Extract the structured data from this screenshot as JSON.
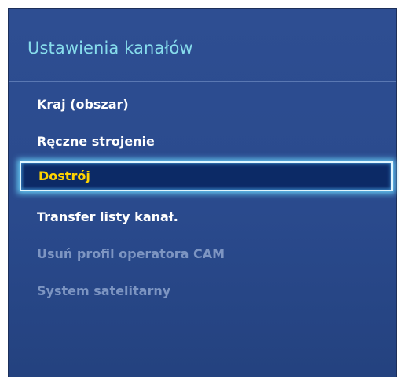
{
  "panel": {
    "title": "Ustawienia kanałów"
  },
  "menu": {
    "items": [
      {
        "label": "Kraj (obszar)",
        "state": "normal"
      },
      {
        "label": "Ręczne strojenie",
        "state": "normal"
      },
      {
        "label": "Dostrój",
        "state": "selected"
      },
      {
        "label": "Transfer listy kanał.",
        "state": "normal"
      },
      {
        "label": "Usuń profil operatora CAM",
        "state": "disabled"
      },
      {
        "label": "System satelitarny",
        "state": "disabled"
      }
    ]
  },
  "colors": {
    "panel_bg": "#2a4a8d",
    "title": "#87ddec",
    "item_normal": "#ffffff",
    "item_selected": "#ffd400",
    "item_disabled": "#7d95c2",
    "selection_bg": "#0c2a66",
    "selection_glow": "#65c8f2"
  }
}
